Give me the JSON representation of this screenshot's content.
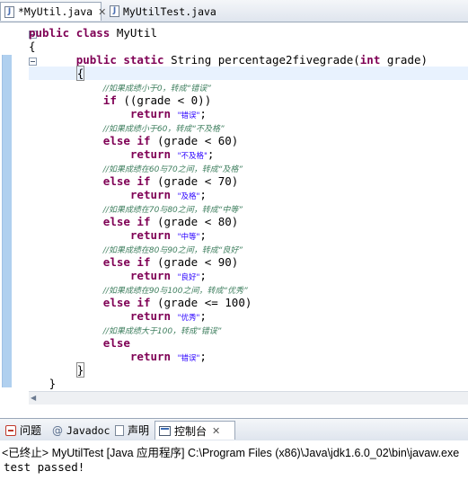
{
  "editor_tabs": [
    {
      "label": "*MyUtil.java",
      "active": true
    },
    {
      "label": "MyUtilTest.java",
      "active": false
    }
  ],
  "code": {
    "class_decl": {
      "kw1": "public",
      "kw2": "class",
      "name": "MyUtil"
    },
    "open_brace": "{",
    "method_decl": {
      "kw1": "public",
      "kw2": "static",
      "rest1": "String percentage2fivegrade(",
      "kw3": "int",
      "rest2": " grade)"
    },
    "method_open": "{",
    "blocks": [
      {
        "comment": "//如果成绩小于0，转成“错误”",
        "cond_kw": "if",
        "cond": " ((grade < 0))",
        "ret_kw": "return",
        "ret_str": "\"错误\"",
        "tail": ";"
      },
      {
        "comment": "//如果成绩小于60，转成“不及格”",
        "cond_kw": "else if",
        "cond": " (grade < 60)",
        "ret_kw": "return",
        "ret_str": "\"不及格\"",
        "tail": ";"
      },
      {
        "comment": "//如果成绩在60与70之间，转成“及格”",
        "cond_kw": "else if",
        "cond": " (grade < 70)",
        "ret_kw": "return",
        "ret_str": "\"及格\"",
        "tail": ";"
      },
      {
        "comment": "//如果成绩在70与80之间，转成“中等”",
        "cond_kw": "else if",
        "cond": " (grade < 80)",
        "ret_kw": "return",
        "ret_str": "\"中等\"",
        "tail": ";"
      },
      {
        "comment": "//如果成绩在80与90之间，转成“良好”",
        "cond_kw": "else if",
        "cond": " (grade < 90)",
        "ret_kw": "return",
        "ret_str": "\"良好\"",
        "tail": ";"
      },
      {
        "comment": "//如果成绩在90与100之间，转成“优秀”",
        "cond_kw": "else if",
        "cond": " (grade <= 100)",
        "ret_kw": "return",
        "ret_str": "\"优秀\"",
        "tail": ";"
      },
      {
        "comment": "//如果成绩大于100，转成“错误”",
        "cond_kw": "else",
        "cond": "",
        "ret_kw": "return",
        "ret_str": "\"错误\"",
        "tail": ";"
      }
    ],
    "method_close": "}",
    "class_close": "}"
  },
  "bottom_tabs": [
    {
      "label": "问题",
      "icon": "problems-icon"
    },
    {
      "label": "Javadoc",
      "icon": "javadoc-icon"
    },
    {
      "label": "声明",
      "icon": "declaration-icon"
    },
    {
      "label": "控制台",
      "icon": "console-icon",
      "active": true
    }
  ],
  "console": {
    "status": "<已终止> MyUtilTest [Java 应用程序] C:\\Program Files (x86)\\Java\\jdk1.6.0_02\\bin\\javaw.exe",
    "output": "test passed!"
  },
  "colors": {
    "keyword": "#7f0055",
    "string": "#2a00ff",
    "comment": "#3f7f5f",
    "current_line": "#e8f2fe",
    "ruler": "#b0d0ef"
  }
}
